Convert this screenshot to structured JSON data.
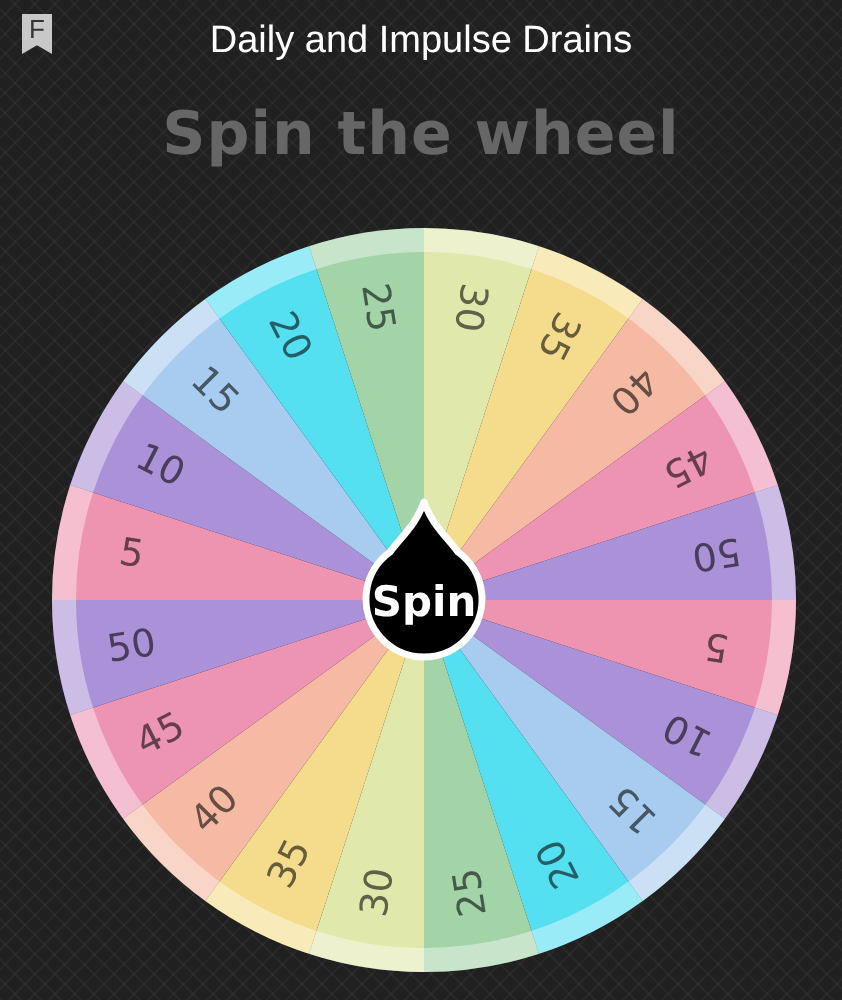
{
  "header": {
    "badge": "F",
    "title": "Daily and Impulse Drains"
  },
  "heading": "Spin the wheel",
  "wheel": {
    "button": "Spin",
    "segments": [
      {
        "label": "30",
        "color": "#e1e8ac"
      },
      {
        "label": "35",
        "color": "#f5dc8c"
      },
      {
        "label": "40",
        "color": "#f6baa4"
      },
      {
        "label": "45",
        "color": "#ed94b4"
      },
      {
        "label": "50",
        "color": "#ab91d8"
      },
      {
        "label": "5",
        "color": "#ee94b0"
      },
      {
        "label": "10",
        "color": "#ab91d8"
      },
      {
        "label": "15",
        "color": "#a8ccef"
      },
      {
        "label": "20",
        "color": "#55e0f2"
      },
      {
        "label": "25",
        "color": "#a3d4a8"
      },
      {
        "label": "30",
        "color": "#e1e8ac"
      },
      {
        "label": "35",
        "color": "#f5dc8c"
      },
      {
        "label": "40",
        "color": "#f6baa4"
      },
      {
        "label": "45",
        "color": "#ed94b4"
      },
      {
        "label": "50",
        "color": "#ab91d8"
      },
      {
        "label": "5",
        "color": "#ee94b0"
      },
      {
        "label": "10",
        "color": "#ab91d8"
      },
      {
        "label": "15",
        "color": "#a8ccef"
      },
      {
        "label": "20",
        "color": "#55e0f2"
      },
      {
        "label": "25",
        "color": "#a3d4a8"
      }
    ]
  }
}
